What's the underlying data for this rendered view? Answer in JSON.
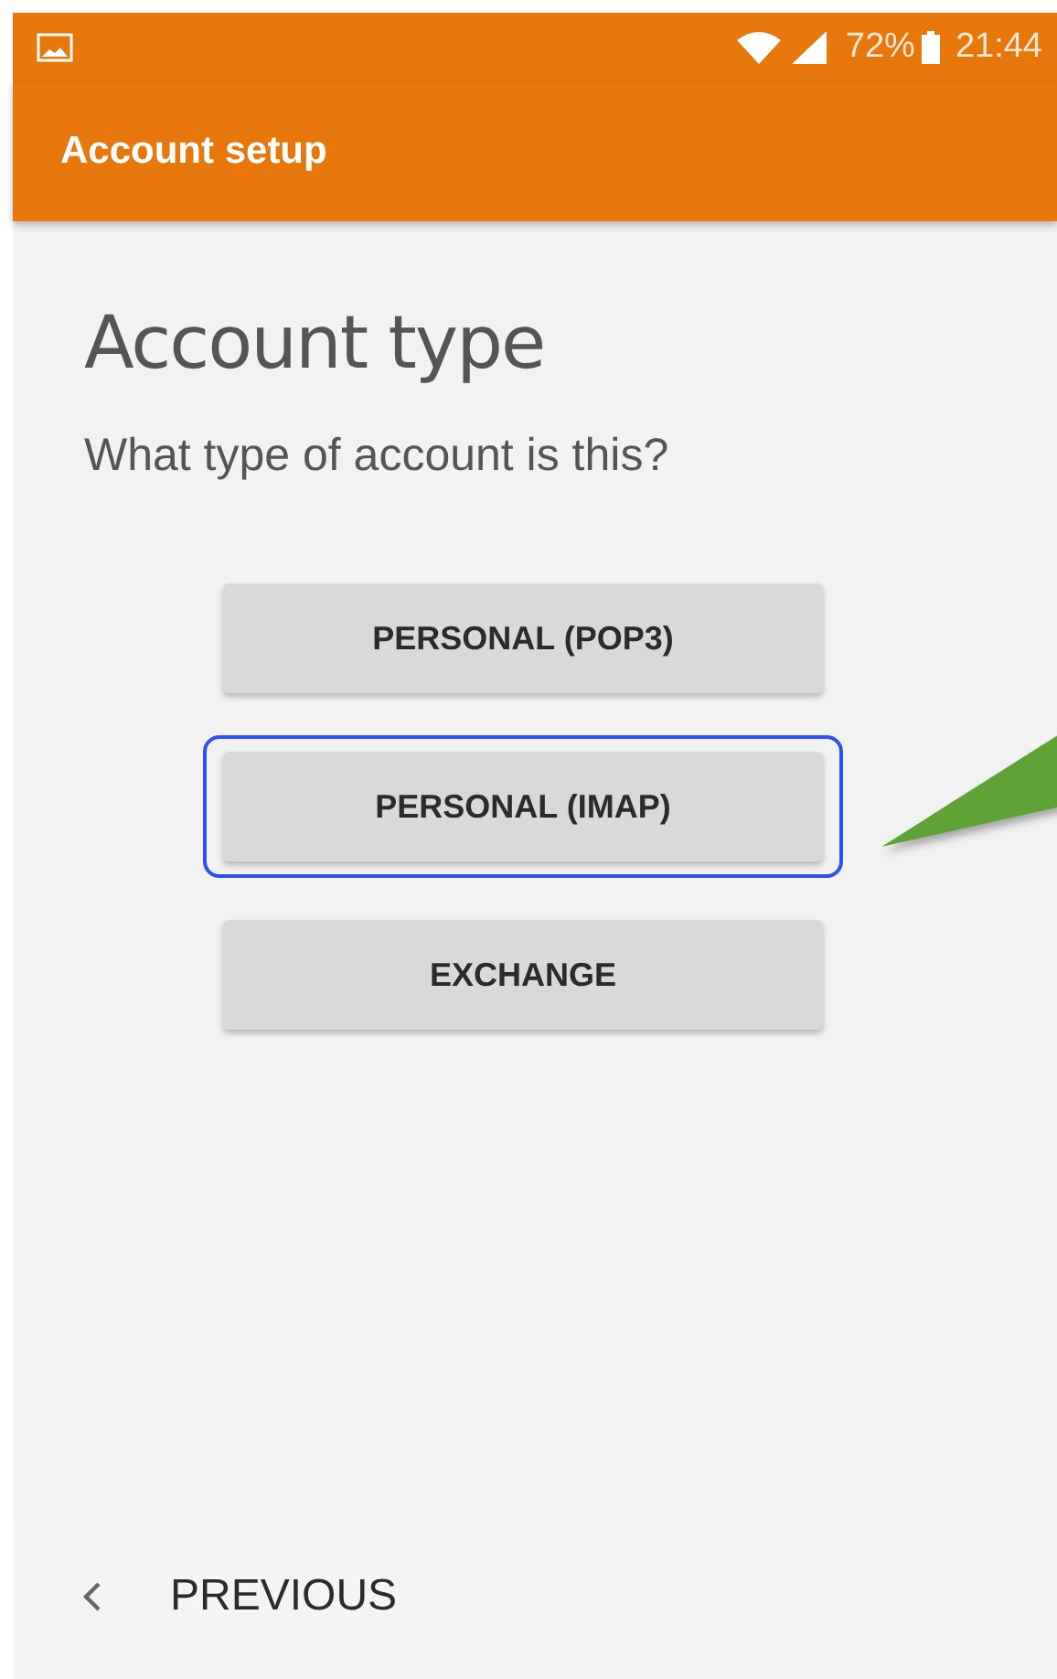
{
  "status_bar": {
    "battery": "72%",
    "time": "21:44"
  },
  "app_bar": {
    "title": "Account setup"
  },
  "heading": "Account type",
  "question": "What type of account is this?",
  "options": [
    {
      "label": "PERSONAL (POP3)",
      "highlighted": false
    },
    {
      "label": "PERSONAL (IMAP)",
      "highlighted": true
    },
    {
      "label": "EXCHANGE",
      "highlighted": false
    }
  ],
  "footer": {
    "back_label": "PREVIOUS"
  }
}
